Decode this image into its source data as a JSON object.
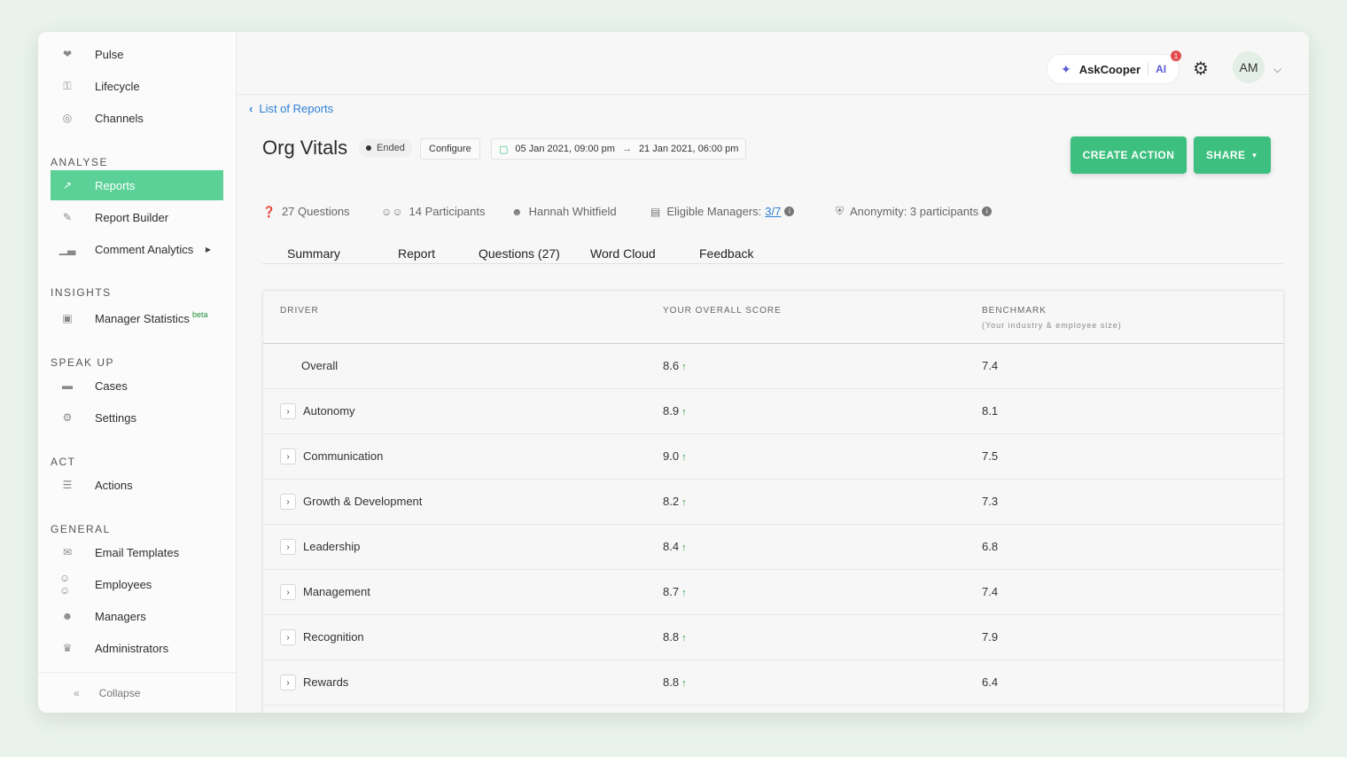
{
  "sidebar": {
    "items_top": [
      {
        "label": "Pulse",
        "icon": "heart-icon"
      },
      {
        "label": "Lifecycle",
        "icon": "key-icon"
      },
      {
        "label": "Channels",
        "icon": "broadcast-icon"
      }
    ],
    "analyse_label": "ANALYSE",
    "analyse": [
      {
        "label": "Reports",
        "icon": "chart-line-icon"
      },
      {
        "label": "Report Builder",
        "icon": "file-edit-icon"
      },
      {
        "label": "Comment Analytics",
        "icon": "bar-chart-icon"
      }
    ],
    "insights_label": "INSIGHTS",
    "insights": [
      {
        "label": "Manager Statistics",
        "badge": "beta",
        "icon": "monitor-icon"
      }
    ],
    "speakup_label": "SPEAK UP",
    "speakup": [
      {
        "label": "Cases",
        "icon": "folder-icon"
      },
      {
        "label": "Settings",
        "icon": "gear-icon"
      }
    ],
    "act_label": "ACT",
    "act": [
      {
        "label": "Actions",
        "icon": "list-icon"
      }
    ],
    "general_label": "GENERAL",
    "general": [
      {
        "label": "Email Templates",
        "icon": "email-icon"
      },
      {
        "label": "Employees",
        "icon": "users-icon"
      },
      {
        "label": "Managers",
        "icon": "user-icon"
      },
      {
        "label": "Administrators",
        "icon": "crown-icon"
      }
    ],
    "collapse_label": "Collapse"
  },
  "topbar": {
    "askcooper_label": "AskCooper",
    "ai_label": "AI",
    "notification_count": "1",
    "avatar_initials": "AM"
  },
  "header": {
    "breadcrumb": "List of Reports",
    "title": "Org Vitals",
    "status": "Ended",
    "configure_label": "Configure",
    "date_start": "05 Jan 2021, 09:00 pm",
    "date_end": "21 Jan 2021, 06:00 pm",
    "create_action_label": "CREATE ACTION",
    "share_label": "SHARE"
  },
  "meta": {
    "questions": "27 Questions",
    "participants": "14 Participants",
    "owner": "Hannah Whitfield",
    "eligible_managers_label": "Eligible Managers:",
    "eligible_managers_value": "3/7",
    "anonymity": "Anonymity: 3 participants"
  },
  "tabs": [
    "Summary",
    "Report",
    "Questions (27)",
    "Word Cloud",
    "Feedback"
  ],
  "table": {
    "headers": {
      "driver": "DRIVER",
      "score": "YOUR OVERALL SCORE",
      "benchmark": "BENCHMARK",
      "benchmark_sub": "(Your industry & employee size)"
    },
    "rows": [
      {
        "driver": "Overall",
        "score": "8.6",
        "benchmark": "7.4"
      },
      {
        "driver": "Autonomy",
        "score": "8.9",
        "benchmark": "8.1"
      },
      {
        "driver": "Communication",
        "score": "9.0",
        "benchmark": "7.5"
      },
      {
        "driver": "Growth & Development",
        "score": "8.2",
        "benchmark": "7.3"
      },
      {
        "driver": "Leadership",
        "score": "8.4",
        "benchmark": "6.8"
      },
      {
        "driver": "Management",
        "score": "8.7",
        "benchmark": "7.4"
      },
      {
        "driver": "Recognition",
        "score": "8.8",
        "benchmark": "7.9"
      },
      {
        "driver": "Rewards",
        "score": "8.8",
        "benchmark": "6.4"
      }
    ]
  }
}
